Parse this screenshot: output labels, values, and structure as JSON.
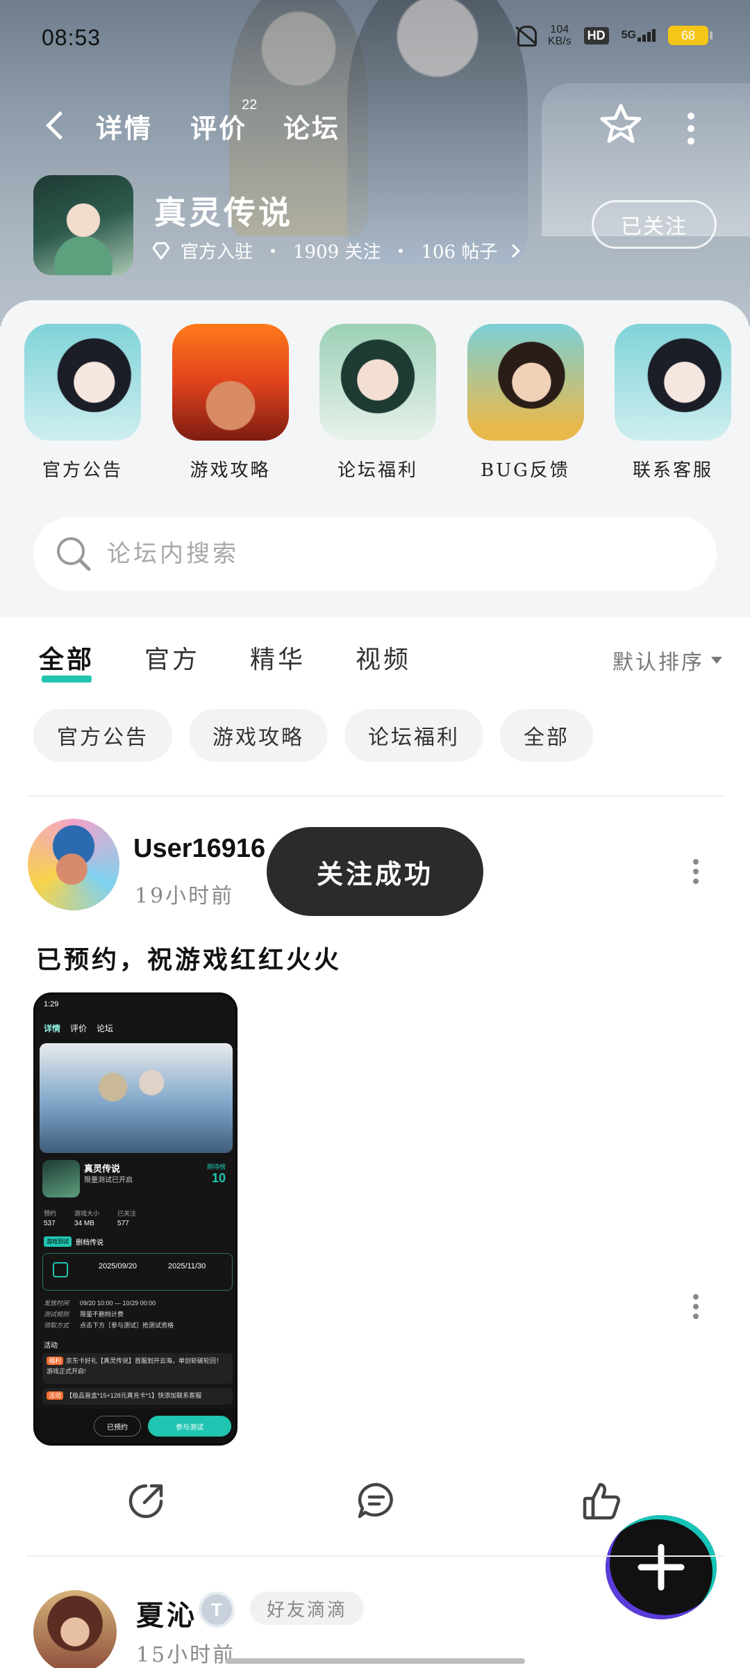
{
  "status_bar": {
    "time": "08:53",
    "net_speed": "104",
    "net_unit": "KB/s",
    "hd": "HD",
    "signal": "5G",
    "battery": "68"
  },
  "nav": {
    "tabs": [
      {
        "label": "详情"
      },
      {
        "label": "评价"
      },
      {
        "label": "论坛"
      }
    ],
    "review_badge": "22",
    "active_tab": "论坛"
  },
  "game": {
    "title": "真灵传说",
    "official": "官方入驻",
    "followers": "1909 关注",
    "posts": "106 帖子",
    "follow_button": "已关注"
  },
  "shortcuts": [
    {
      "label": "官方公告",
      "icon": "official-notice-icon"
    },
    {
      "label": "游戏攻略",
      "icon": "game-guide-icon"
    },
    {
      "label": "论坛福利",
      "icon": "forum-welfare-icon"
    },
    {
      "label": "BUG反馈",
      "icon": "bug-feedback-icon"
    },
    {
      "label": "联系客服",
      "icon": "customer-service-icon"
    }
  ],
  "search": {
    "placeholder": "论坛内搜索"
  },
  "filter_tabs": [
    {
      "label": "全部"
    },
    {
      "label": "官方"
    },
    {
      "label": "精华"
    },
    {
      "label": "视频"
    }
  ],
  "sort": "默认排序",
  "chips": [
    {
      "label": "官方公告"
    },
    {
      "label": "游戏攻略"
    },
    {
      "label": "论坛福利"
    },
    {
      "label": "全部"
    }
  ],
  "toast": "关注成功",
  "post1": {
    "username": "User16916",
    "time": "19小时前",
    "text": "已预约，祝游戏红红火火",
    "screenshot": {
      "time": "1:29",
      "tabs": [
        "详情",
        "评价",
        "论坛"
      ],
      "game_name": "真灵传说",
      "game_sub": "限量测试已开启",
      "rank_label": "期待榜",
      "rank": "10",
      "stats": [
        {
          "label": "预约",
          "value": "537"
        },
        {
          "label": "游戏大小",
          "value": "34 MB"
        },
        {
          "label": "已关注",
          "value": "577"
        }
      ],
      "tag": "游戏测试",
      "test_name": "删档传说",
      "date_start": "2025/09/20",
      "date_end": "2025/11/30",
      "info1_label": "发放时间",
      "info1": "09/20 10:00 — 10/29 00:00",
      "info2_label": "测试规则",
      "info2": "限量不删档计费",
      "info3_label": "领取方式",
      "info3": "点击下方［参与测试］抢测试资格",
      "activity": "活动",
      "ann1_tag": "福利",
      "ann1": "京东卡好礼【真灵传说】首服划开云海，单剑斩破轮回！游戏正式开启!",
      "ann2_tag": "活动",
      "ann2": "【极品盲盒*15+128元真充卡*1】快添加联系客服",
      "btn_reserved": "已预约",
      "btn_join": "参与测试"
    }
  },
  "post2": {
    "username": "夏沁",
    "level": "T",
    "tag": "好友滴滴",
    "time": "15小时前"
  }
}
